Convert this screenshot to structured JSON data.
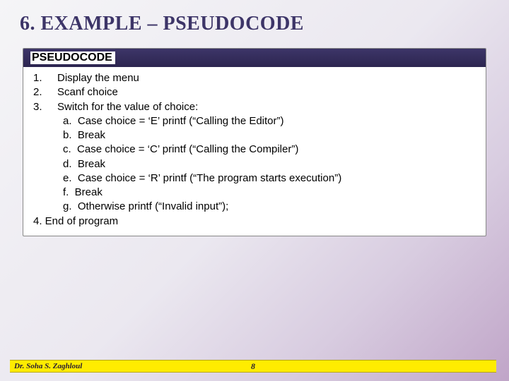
{
  "title": "6. EXAMPLE – PSEUDOCODE",
  "panel": {
    "header": "PSEUDOCODE",
    "lines": {
      "l1": "Display the menu",
      "l2": "Scanf choice",
      "l3": "Switch for the value of choice:",
      "a": "Case choice = ‘E’ printf (“Calling the Editor”)",
      "b": "Break",
      "c": "Case choice = ‘C’ printf (“Calling the Compiler”)",
      "d": "Break",
      "e": "Case choice = ‘R’ printf (“The program starts execution”)",
      "f": "Break",
      "g": "Otherwise printf (“Invalid input”);",
      "l4": "4. End of program"
    }
  },
  "footer": {
    "author": "Dr. Soha S. Zaghloul",
    "page": "8"
  }
}
